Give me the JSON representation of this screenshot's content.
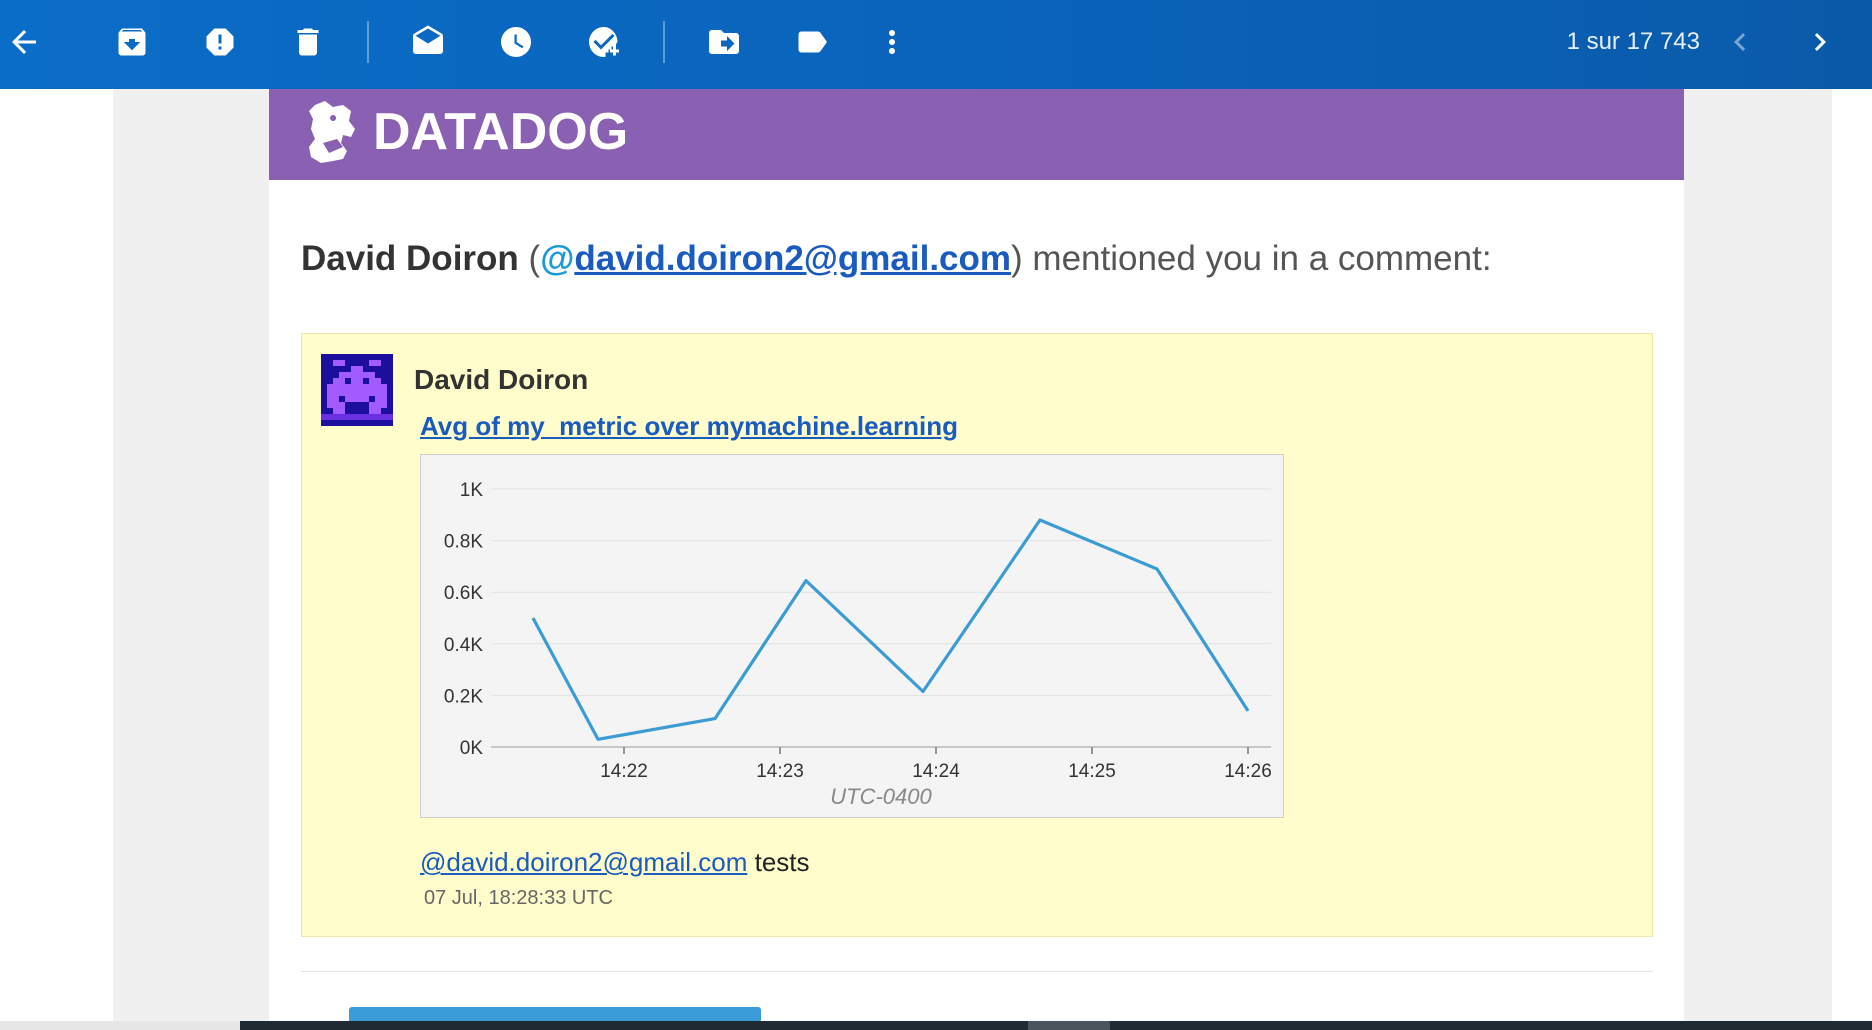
{
  "toolbar": {
    "counter": "1 sur 17 743",
    "icons": [
      "back-arrow-icon",
      "archive-icon",
      "report-spam-icon",
      "delete-icon",
      "mark-unread-icon",
      "snooze-icon",
      "add-task-icon",
      "move-to-icon",
      "label-icon",
      "more-vert-icon",
      "chevron-left-icon",
      "chevron-right-icon"
    ]
  },
  "banner": {
    "brand": "DATADOG",
    "color": "#8a60b2"
  },
  "headline": {
    "author": "David Doiron",
    "open_paren": " (",
    "at": "@",
    "email": "david.doiron2@gmail.com",
    "suffix": ") mentioned you in a comment:"
  },
  "comment": {
    "author": "David Doiron",
    "graph_title": "Avg of my_metric over mymachine.learning",
    "mention": "@david.doiron2@gmail.com",
    "body_text": " tests",
    "timestamp": "07 Jul, 18:28:33 UTC"
  },
  "chart_data": {
    "type": "line",
    "title": "Avg of my_metric over mymachine.learning",
    "xlabel": "UTC-0400",
    "ylabel": "",
    "x_ticks": [
      "14:22",
      "14:23",
      "14:24",
      "14:25",
      "14:26"
    ],
    "y_ticks": [
      "1K",
      "0.8K",
      "0.6K",
      "0.4K",
      "0.2K",
      "0K"
    ],
    "ylim": [
      0,
      1000
    ],
    "grid": true,
    "series": [
      {
        "color": "#3a9bd5",
        "x": [
          "14:21:25",
          "14:21:50",
          "14:22:35",
          "14:23:10",
          "14:23:55",
          "14:24:40",
          "14:25:25",
          "14:26:00"
        ],
        "values": [
          500,
          30,
          110,
          645,
          215,
          880,
          690,
          140
        ]
      }
    ]
  }
}
